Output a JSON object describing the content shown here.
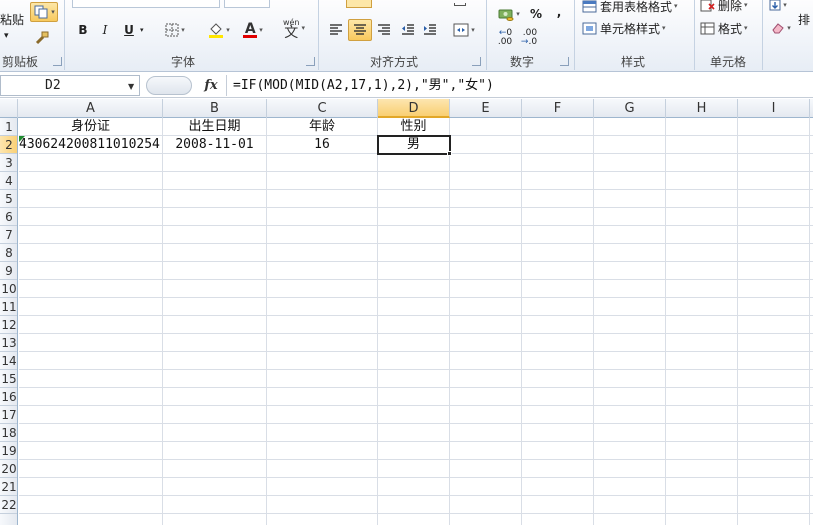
{
  "ribbon": {
    "clipboard": {
      "paste_label": "粘贴",
      "label": "剪贴板"
    },
    "font": {
      "label": "字体",
      "bold": "B",
      "italic": "I",
      "underline": "U",
      "font_color_letter": "A",
      "wen_label": "wén",
      "wen_char": "文"
    },
    "alignment": {
      "label": "对齐方式"
    },
    "number": {
      "label": "数字",
      "percent": "%",
      "comma": ",",
      "dec_increase_top": "0",
      "dec_increase_bottom": ".00",
      "dec_decrease_top": ".00",
      "dec_decrease_bottom": ".0"
    },
    "styles": {
      "label": "样式",
      "table_format": "套用表格格式",
      "cell_styles": "单元格样式"
    },
    "cells": {
      "label": "单元格",
      "delete": "删除",
      "format": "格式"
    },
    "editing": {
      "sort_partial": "排"
    }
  },
  "formula_bar": {
    "name_box": "D2",
    "fx": "fx",
    "formula": "=IF(MOD(MID(A2,17,1),2),\"男\",\"女\")"
  },
  "grid": {
    "columns": [
      "A",
      "B",
      "C",
      "D",
      "E",
      "F",
      "G",
      "H",
      "I"
    ],
    "selected_column": "D",
    "rows": [
      "1",
      "2",
      "3",
      "4",
      "5",
      "6",
      "7",
      "8",
      "9",
      "10",
      "11",
      "12",
      "13",
      "14",
      "15",
      "16",
      "17",
      "18",
      "19",
      "20",
      "21",
      "22"
    ],
    "selected_row": "2",
    "row1": {
      "A": "身份证",
      "B": "出生日期",
      "C": "年龄",
      "D": "性别"
    },
    "row2": {
      "A": "430624200811010254",
      "B": "2008-11-01",
      "C": "16",
      "D": "男"
    }
  },
  "colors": {
    "accent": "#f9cf72",
    "grid_line": "#d9dee6",
    "error_triangle": "#1e8a2e"
  }
}
